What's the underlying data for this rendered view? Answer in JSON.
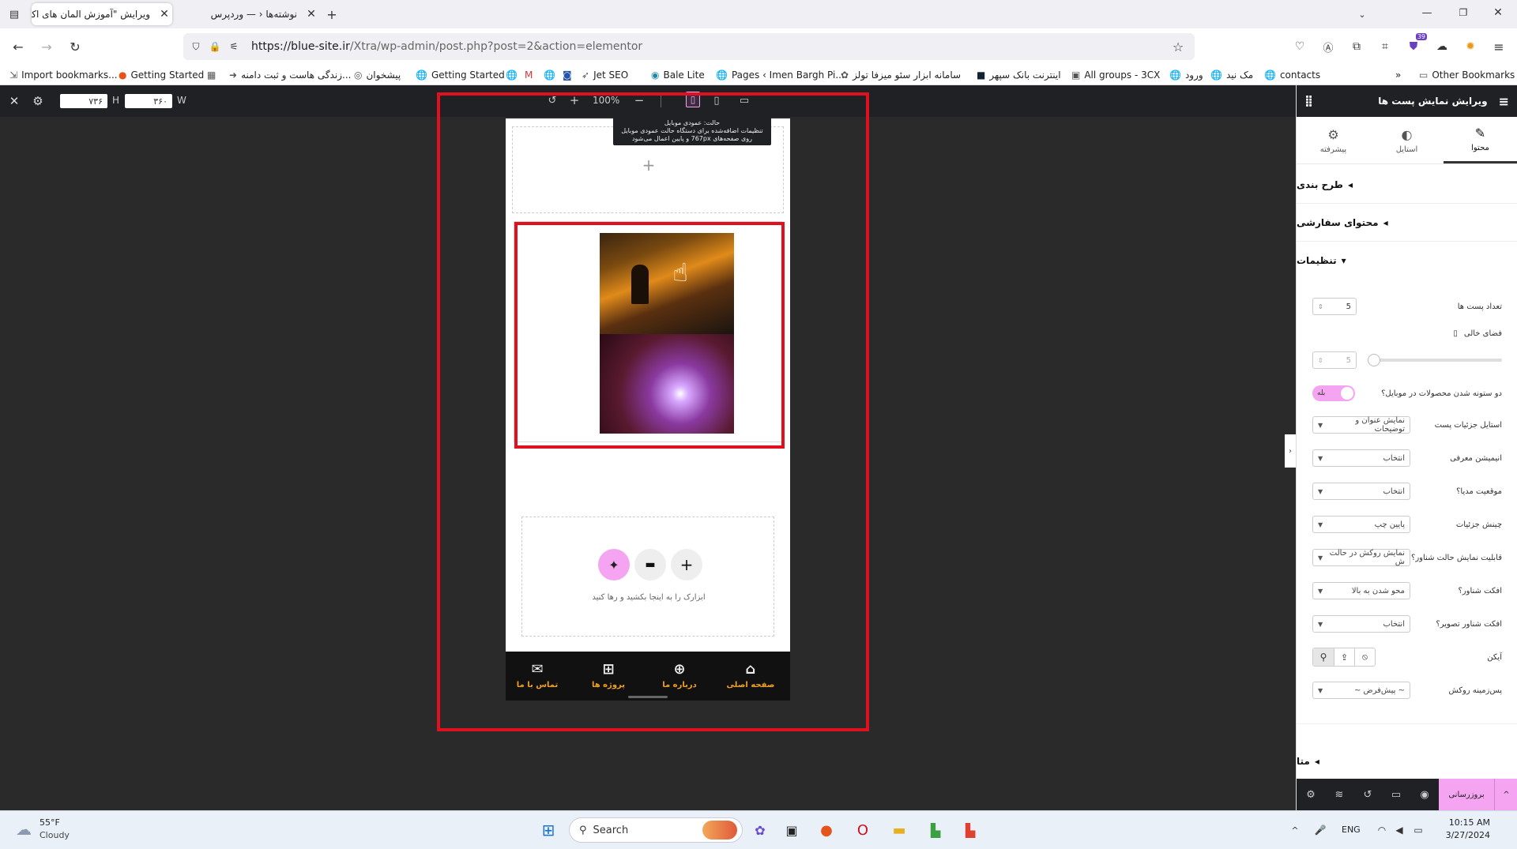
{
  "browser": {
    "tabs": [
      {
        "title": "ویرایش \"آموزش المان های اکسترا - ...",
        "active": true
      },
      {
        "title": "نوشته‌ها ‹ — وردپرس",
        "active": false
      }
    ],
    "url_domain": "https://blue-site.ir",
    "url_path": "/Xtra/wp-admin/post.php?post=2&action=elementor",
    "ext_badge": "39",
    "bookmarks": [
      "Import bookmarks...",
      "Getting Started",
      "زندگی هاست و ثبت دامنه...",
      "پیشخوان",
      "Getting Started",
      "Jet SEO",
      "Bale Lite",
      "Pages ‹ Imen Bargh Pi...",
      "سامانه ابزار سئو میزفا تولز",
      "اینترنت بانک سپهر",
      "All groups - 3CX",
      "ورود",
      "مک نید",
      "contacts"
    ],
    "other_bookmarks": "Other Bookmarks"
  },
  "editor": {
    "width_label": "W",
    "width_value": "۳۶۰",
    "height_label": "H",
    "height_value": "۷۳۶",
    "zoom": "100%",
    "tooltip_line1": "حالت: عمودی موبایل",
    "tooltip_line2": "تنظیمات اضافه‌شده برای دستگاه حالت عمودی موبایل",
    "tooltip_line3": "روی صفحه‌های 767px و پایین اعمال می‌شود",
    "dropzone_text": "ابزارک را به اینجا بکشید و رها کنید",
    "bottom_nav": [
      {
        "label": "تماس با ما",
        "icon": "mail-icon"
      },
      {
        "label": "پروژه ها",
        "icon": "grid-icon"
      },
      {
        "label": "درباره ما",
        "icon": "globe-icon"
      },
      {
        "label": "صفحه اصلی",
        "icon": "home-icon"
      }
    ]
  },
  "panel": {
    "title": "ویرایش نمایش پست ها",
    "tabs": [
      {
        "label": "پیشرفته",
        "icon": "gear-icon"
      },
      {
        "label": "استایل",
        "icon": "half-circle-icon"
      },
      {
        "label": "محتوا",
        "icon": "pencil-icon",
        "active": true
      }
    ],
    "sections": {
      "layout": "طرح بندی",
      "custom_content": "محتوای سفارشی",
      "settings": "تنظیمات",
      "meta": "متا"
    },
    "fields": {
      "posts_count_label": "تعداد پست ها",
      "posts_count_value": "5",
      "gap_label": "فضای خالی",
      "gap_value": "5",
      "gap_slider_level": 0,
      "two_col_label": "دو ستونه شدن محصولات در موبایل؟",
      "two_col_toggle": "بله",
      "post_details_style_label": "استایل جزئیات پست",
      "post_details_style_value": "نمایش عنوان و توضیحات",
      "intro_animation_label": "انیمیشن معرفی",
      "intro_animation_value": "انتخاب",
      "media_position_label": "موقعیت مدیا؟",
      "media_position_value": "انتخاب",
      "details_layout_label": "چینش جزئیات",
      "details_layout_value": "پایین چپ",
      "hover_display_label": "قابلیت نمایش حالت شناور؟",
      "hover_display_value": "نمایش روکش در حالت ش",
      "hover_effect_label": "افکت شناور؟",
      "hover_effect_value": "محو شدن به بالا",
      "image_hover_effect_label": "افکت شناور تصویر؟",
      "image_hover_effect_value": "انتخاب",
      "icon_label": "آیکن",
      "overlay_bg_label": "پس‌زمینه روکش",
      "overlay_bg_value": "~ پیش‌فرض ~"
    },
    "footer_button": "بروزرسانی"
  },
  "taskbar": {
    "weather_temp": "55°F",
    "weather_desc": "Cloudy",
    "search_placeholder": "Search",
    "lang": "ENG",
    "time": "10:15 AM",
    "date": "3/27/2024"
  },
  "colors": {
    "highlight_red": "#e0101f",
    "accent_pink": "#f4a4f0",
    "nav_orange": "#f0a020"
  }
}
